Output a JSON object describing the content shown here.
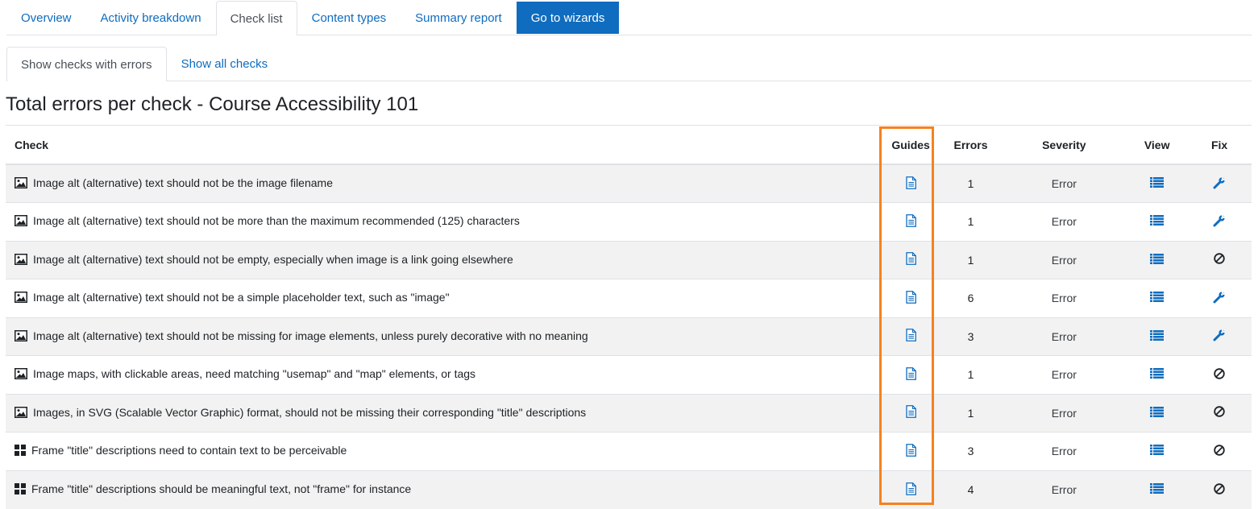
{
  "nav": {
    "tabs": [
      {
        "label": "Overview"
      },
      {
        "label": "Activity breakdown"
      },
      {
        "label": "Check list"
      },
      {
        "label": "Content types"
      },
      {
        "label": "Summary report"
      },
      {
        "label": "Go to wizards"
      }
    ],
    "active_tab": "Check list"
  },
  "subnav": {
    "tabs": [
      {
        "label": "Show checks with errors"
      },
      {
        "label": "Show all checks"
      }
    ],
    "active_tab": "Show checks with errors"
  },
  "title": "Total errors per check - Course Accessibility 101",
  "table": {
    "headers": {
      "check": "Check",
      "guides": "Guides",
      "errors": "Errors",
      "severity": "Severity",
      "view": "View",
      "fix": "Fix"
    },
    "rows": [
      {
        "type_icon": "image-icon",
        "check": "Image alt (alternative) text should not be the image filename",
        "errors": "1",
        "severity": "Error",
        "fix_icon": "wrench-icon"
      },
      {
        "type_icon": "image-icon",
        "check": "Image alt (alternative) text should not be more than the maximum recommended (125) characters",
        "errors": "1",
        "severity": "Error",
        "fix_icon": "wrench-icon"
      },
      {
        "type_icon": "image-icon",
        "check": "Image alt (alternative) text should not be empty, especially when image is a link going elsewhere",
        "errors": "1",
        "severity": "Error",
        "fix_icon": "ban-icon"
      },
      {
        "type_icon": "image-icon",
        "check": "Image alt (alternative) text should not be a simple placeholder text, such as \"image\"",
        "errors": "6",
        "severity": "Error",
        "fix_icon": "wrench-icon"
      },
      {
        "type_icon": "image-icon",
        "check": "Image alt (alternative) text should not be missing for image elements, unless purely decorative with no meaning",
        "errors": "3",
        "severity": "Error",
        "fix_icon": "wrench-icon"
      },
      {
        "type_icon": "image-icon",
        "check": "Image maps, with clickable areas, need matching \"usemap\" and \"map\" elements, or tags",
        "errors": "1",
        "severity": "Error",
        "fix_icon": "ban-icon"
      },
      {
        "type_icon": "image-icon",
        "check": "Images, in SVG (Scalable Vector Graphic) format, should not be missing their corresponding \"title\" descriptions",
        "errors": "1",
        "severity": "Error",
        "fix_icon": "ban-icon"
      },
      {
        "type_icon": "frame-icon",
        "check": "Frame \"title\" descriptions need to contain text to be perceivable",
        "errors": "3",
        "severity": "Error",
        "fix_icon": "ban-icon"
      },
      {
        "type_icon": "frame-icon",
        "check": "Frame \"title\" descriptions should be meaningful text, not \"frame\" for instance",
        "errors": "4",
        "severity": "Error",
        "fix_icon": "ban-icon"
      }
    ]
  },
  "colors": {
    "link": "#0f6cbf",
    "highlight": "#f5821f",
    "stripe": "#f2f2f2"
  }
}
